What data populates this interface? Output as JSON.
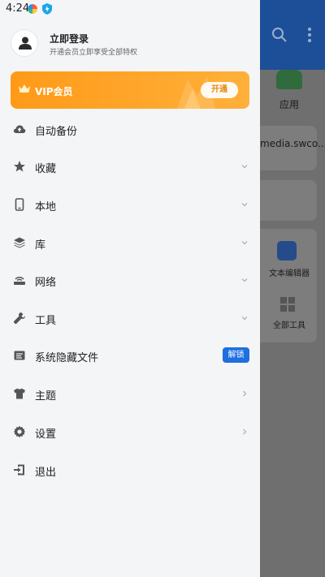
{
  "status_bar": {
    "time": "4:24"
  },
  "user": {
    "login_title": "立即登录",
    "login_subtitle": "开通会员立即享受全部特权"
  },
  "vip": {
    "label": "VIP会员",
    "button": "开通",
    "color": "#ff9a18"
  },
  "menu": {
    "items": [
      {
        "label": "自动备份",
        "icon": "cloud-backup-icon",
        "trailing": "none"
      },
      {
        "label": "收藏",
        "icon": "star-icon",
        "trailing": "chevron-down"
      },
      {
        "label": "本地",
        "icon": "phone-icon",
        "trailing": "chevron-down"
      },
      {
        "label": "库",
        "icon": "stack-icon",
        "trailing": "chevron-down"
      },
      {
        "label": "网络",
        "icon": "router-icon",
        "trailing": "chevron-down"
      },
      {
        "label": "工具",
        "icon": "wrench-icon",
        "trailing": "chevron-down"
      },
      {
        "label": "系统隐藏文件",
        "icon": "hidden-file-icon",
        "trailing": "badge",
        "badge": "解锁"
      },
      {
        "label": "主题",
        "icon": "shirt-icon",
        "trailing": "chevron-right"
      },
      {
        "label": "设置",
        "icon": "gear-icon",
        "trailing": "chevron-right"
      },
      {
        "label": "退出",
        "icon": "exit-icon",
        "trailing": "none"
      }
    ]
  },
  "background": {
    "apps_label": "应用",
    "card_text": "media.swco...",
    "editor_label": "文本编辑器",
    "all_tools_label": "全部工具",
    "header_color": "#1c4f97"
  }
}
